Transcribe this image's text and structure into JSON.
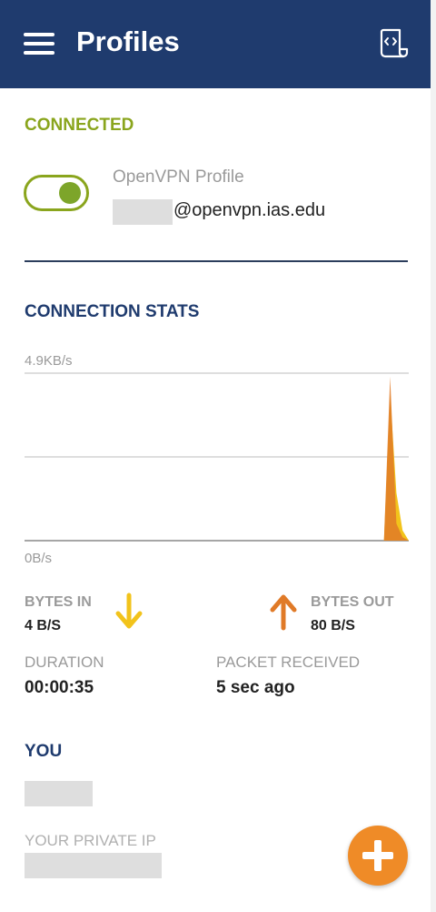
{
  "header": {
    "title": "Profiles",
    "menu_icon": "hamburger-menu-icon",
    "action_icon": "import-profile-icon"
  },
  "connection": {
    "status": "CONNECTED",
    "status_color": "#8aa51d",
    "toggle_on": true,
    "profile_name": "OpenVPN Profile",
    "profile_host": "@openvpn.ias.edu"
  },
  "stats": {
    "title": "CONNECTION STATS",
    "chart_data": {
      "type": "area",
      "ylabel_top": "4.9KB/s",
      "ylabel_bottom": "0B/s",
      "ylim": [
        0,
        4.9
      ],
      "grid": true,
      "series": [
        {
          "color": "#f2c31b",
          "values": [
            0,
            0,
            0,
            0,
            0,
            0,
            0,
            0,
            0,
            0,
            0,
            0,
            0,
            0,
            0,
            0,
            0,
            0,
            0,
            0,
            0,
            0,
            0,
            0,
            0,
            0,
            0,
            0,
            0,
            0,
            0,
            0,
            0,
            0,
            0,
            0,
            0,
            0,
            0,
            0,
            0,
            0,
            0,
            0,
            0,
            0,
            0,
            0,
            0,
            0,
            0,
            0,
            0,
            0,
            0,
            0,
            0,
            0,
            0,
            4.3,
            1.4,
            0.3,
            0
          ]
        },
        {
          "color": "#e07a27",
          "values": [
            0,
            0,
            0,
            0,
            0,
            0,
            0,
            0,
            0,
            0,
            0,
            0,
            0,
            0,
            0,
            0,
            0,
            0,
            0,
            0,
            0,
            0,
            0,
            0,
            0,
            0,
            0,
            0,
            0,
            0,
            0,
            0,
            0,
            0,
            0,
            0,
            0,
            0,
            0,
            0,
            0,
            0,
            0,
            0,
            0,
            0,
            0,
            0,
            0,
            0,
            0,
            0,
            0,
            0,
            0,
            0,
            0,
            0,
            0,
            4.8,
            0.5,
            0.1,
            0
          ]
        }
      ]
    },
    "bytes_in_label": "BYTES IN",
    "bytes_in_value": "4 B/S",
    "bytes_in_color": "#f2c31b",
    "bytes_out_label": "BYTES OUT",
    "bytes_out_value": "80 B/S",
    "bytes_out_color": "#e07a27",
    "duration_label": "DURATION",
    "duration_value": "00:00:35",
    "packet_label": "PACKET RECEIVED",
    "packet_value": "5 sec ago"
  },
  "you": {
    "title": "YOU",
    "private_ip_label": "YOUR PRIVATE IP"
  },
  "fab": {
    "icon": "add-icon",
    "color": "#ef8b27"
  }
}
